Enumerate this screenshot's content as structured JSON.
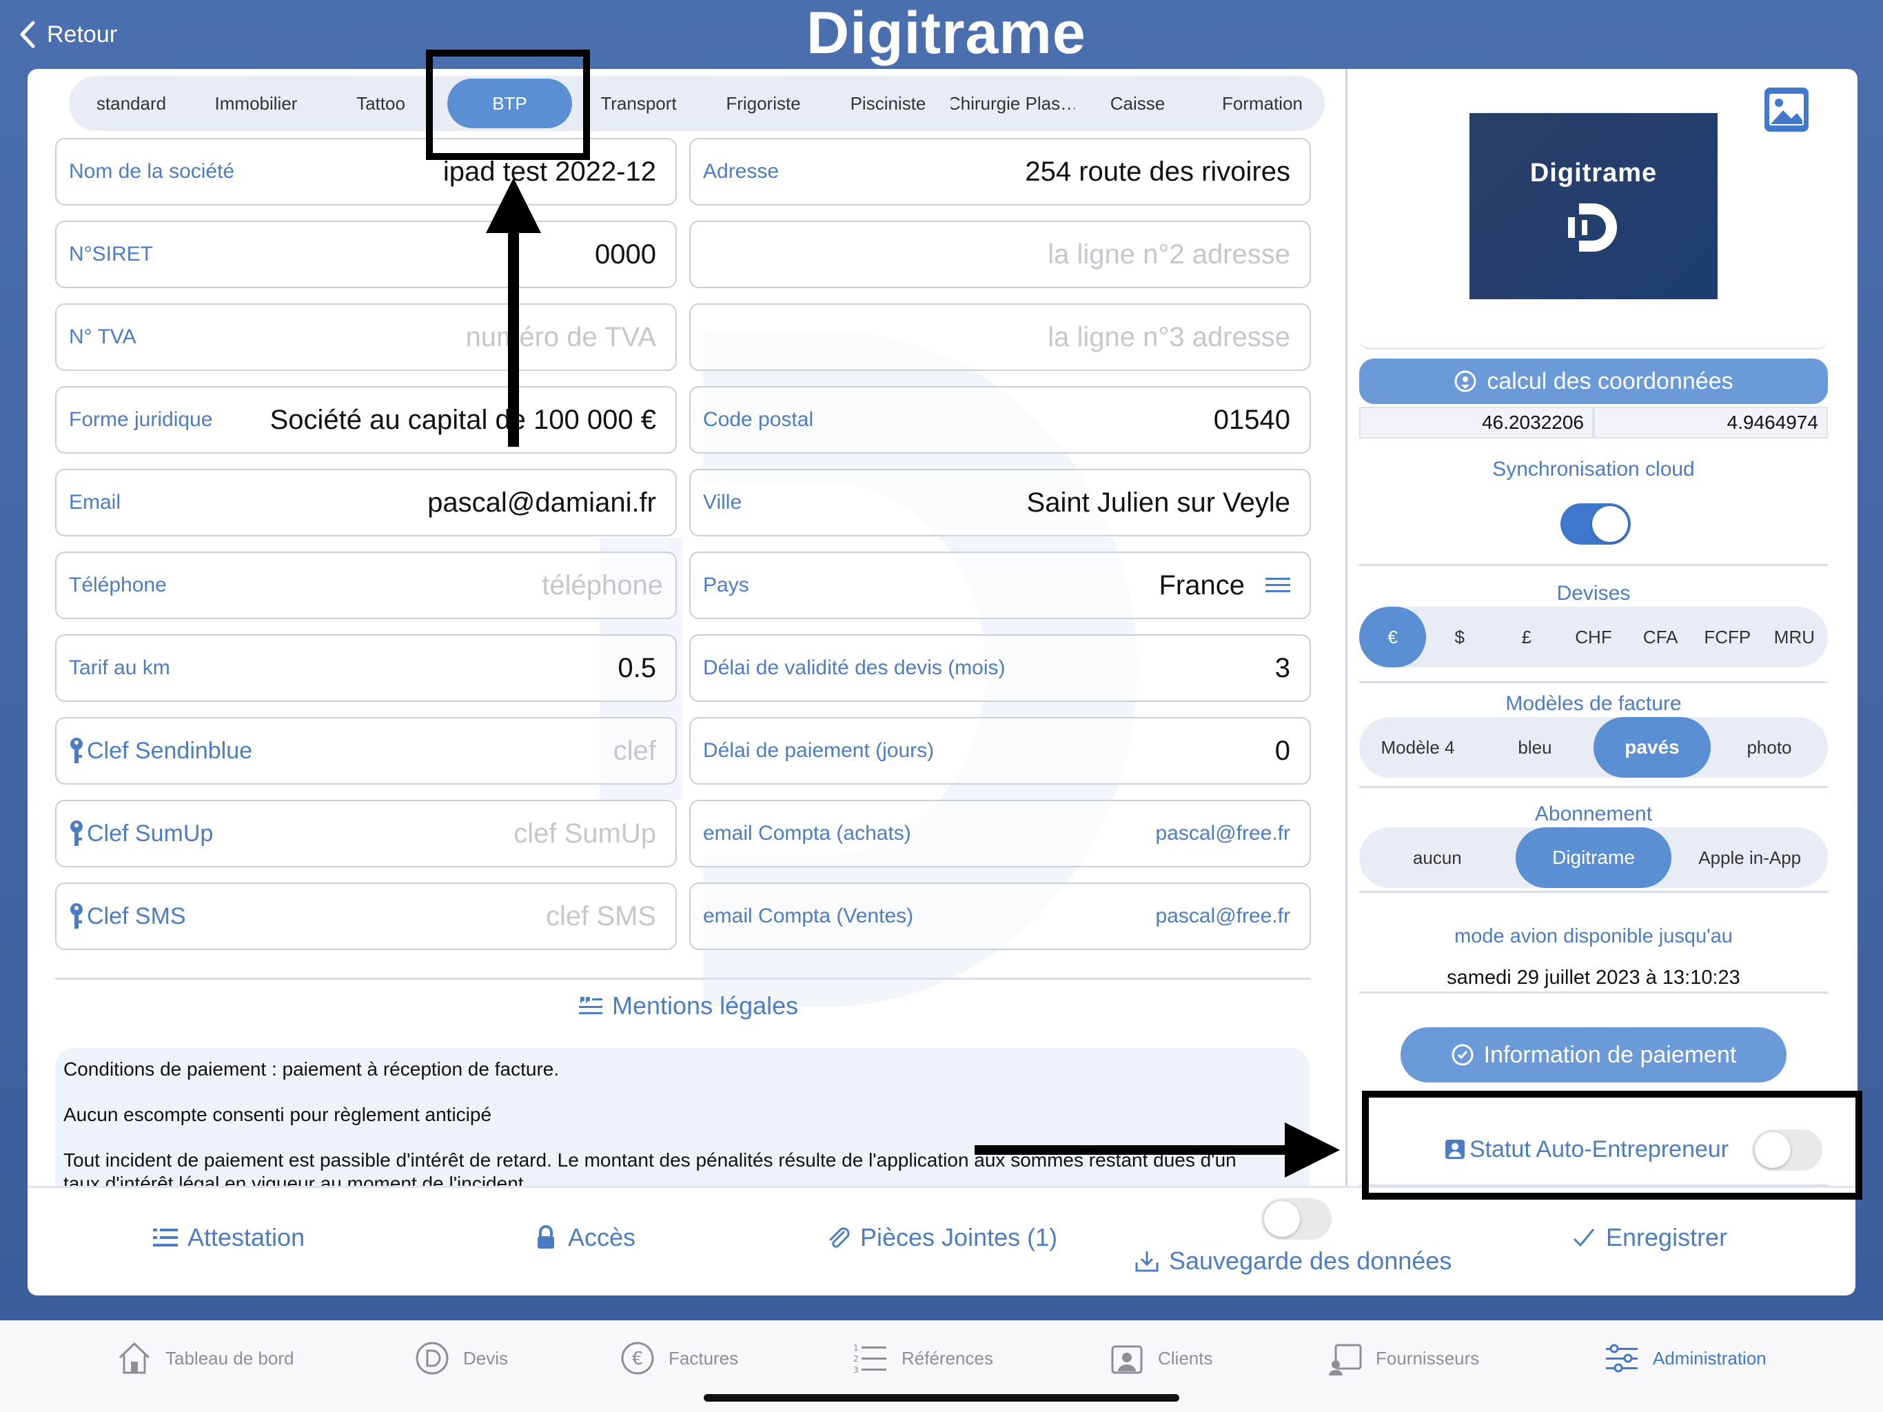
{
  "header": {
    "back_label": "Retour",
    "brand": "Digitrame"
  },
  "categories": {
    "items": [
      "standard",
      "Immobilier",
      "Tattoo",
      "BTP",
      "Transport",
      "Frigoriste",
      "Pisciniste",
      "Chirurgie Plas…",
      "Caisse",
      "Formation"
    ],
    "selected": "BTP"
  },
  "left_fields": [
    {
      "label": "Nom de la société",
      "value": "ipad test 2022-12",
      "placeholder": ""
    },
    {
      "label": "N°SIRET",
      "value": "0000",
      "placeholder": ""
    },
    {
      "label": "N° TVA",
      "value": "",
      "placeholder": "numéro de TVA"
    },
    {
      "label": "Forme juridique",
      "value": "Société au capital de 100 000 €",
      "placeholder": ""
    },
    {
      "label": "Email",
      "value": "pascal@damiani.fr",
      "placeholder": ""
    },
    {
      "label": "Téléphone",
      "value": "",
      "placeholder": "téléphone"
    },
    {
      "label": "Tarif au km",
      "value": "0.5",
      "placeholder": ""
    },
    {
      "label": "Clef Sendinblue",
      "value": "",
      "placeholder": "clef"
    },
    {
      "label": "Clef SumUp",
      "value": "",
      "placeholder": "clef SumUp"
    },
    {
      "label": "Clef SMS",
      "value": "",
      "placeholder": "clef SMS"
    }
  ],
  "right_fields": [
    {
      "label": "Adresse",
      "value": "254 route des rivoires",
      "placeholder": ""
    },
    {
      "label": "",
      "value": "",
      "placeholder": "la ligne n°2 adresse"
    },
    {
      "label": "",
      "value": "",
      "placeholder": "la ligne n°3 adresse"
    },
    {
      "label": "Code postal",
      "value": "01540",
      "placeholder": ""
    },
    {
      "label": "Ville",
      "value": "Saint Julien sur Veyle",
      "placeholder": ""
    },
    {
      "label": "Pays",
      "value": "France",
      "placeholder": ""
    },
    {
      "label": "Délai de validité des devis (mois)",
      "value": "3",
      "placeholder": ""
    },
    {
      "label": "Délai de paiement (jours)",
      "value": "0",
      "placeholder": ""
    },
    {
      "label": "email Compta (achats)",
      "value": "pascal@free.fr",
      "placeholder": ""
    },
    {
      "label": "email Compta (Ventes)",
      "value": "pascal@free.fr",
      "placeholder": ""
    }
  ],
  "mentions": {
    "title": "Mentions légales",
    "lines": [
      "Conditions de paiement : paiement à réception de facture.",
      "Aucun escompte consenti pour règlement anticipé",
      "Tout incident de paiement est passible d'intérêt de retard. Le montant des pénalités résulte de l'application aux sommes restant dues d'un",
      "taux d'intérêt légal en vigueur au moment de l'incident."
    ]
  },
  "sidebar": {
    "logo_text": "Digitrame",
    "calc_button": "calcul des coordonnées",
    "latitude": "46.2032206",
    "longitude": "4.9464974",
    "sync_label": "Synchronisation cloud",
    "sync_on": true,
    "currencies_title": "Devises",
    "currencies": [
      "€",
      "$",
      "£",
      "CHF",
      "CFA",
      "FCFP",
      "MRU"
    ],
    "currency_selected": "€",
    "invoice_title": "Modèles de facture",
    "invoice_models": [
      "Modèle 4",
      "bleu",
      "pavés",
      "photo"
    ],
    "invoice_selected": "pavés",
    "subscription_title": "Abonnement",
    "subscriptions": [
      "aucun",
      "Digitrame",
      "Apple in-App"
    ],
    "subscription_selected": "Digitrame",
    "airplane_label": "mode avion disponible jusqu'au",
    "airplane_date": "samedi 29 juillet 2023 à 13:10:23",
    "payment_info_button": "Information de paiement",
    "statut_label": "Statut Auto-Entrepreneur",
    "statut_on": false
  },
  "bottom_actions": {
    "attestation": "Attestation",
    "acces": "Accès",
    "pieces": "Pièces Jointes (1)",
    "sauvegarde": "Sauvegarde des données",
    "enregistrer": "Enregistrer"
  },
  "tabbar": {
    "items": [
      "Tableau de bord",
      "Devis",
      "Factures",
      "Références",
      "Clients",
      "Fournisseurs",
      "Administration"
    ],
    "active": "Administration"
  },
  "colors": {
    "accent": "#4c7cc4",
    "selected": "#5b8fd4",
    "header_bg": "#4a6faf"
  }
}
